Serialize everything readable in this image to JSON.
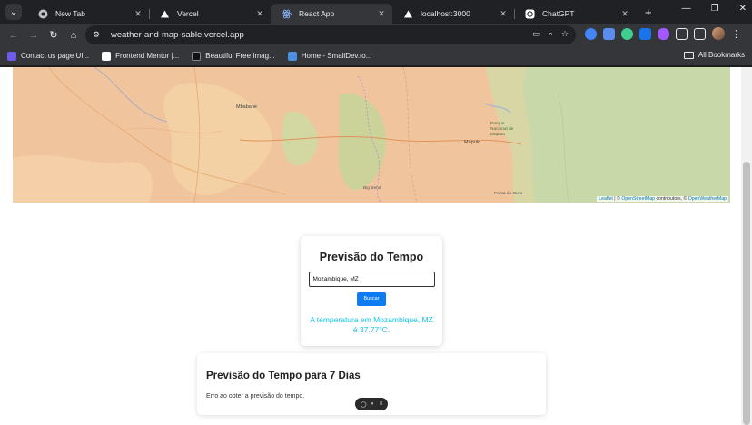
{
  "tabs": [
    {
      "title": "New Tab",
      "icon": "chrome-icon",
      "active": false
    },
    {
      "title": "Vercel",
      "icon": "vercel-triangle-icon",
      "active": false
    },
    {
      "title": "React App",
      "icon": "react-icon",
      "active": true
    },
    {
      "title": "localhost:3000",
      "icon": "vercel-triangle-icon",
      "active": false
    },
    {
      "title": "ChatGPT",
      "icon": "chatgpt-icon",
      "active": false
    }
  ],
  "toolbar": {
    "url": "weather-and-map-sable.vercel.app"
  },
  "bookmarks": [
    {
      "label": "Contact us page UI...",
      "color": "#6c5ce7"
    },
    {
      "label": "Frontend Mentor |...",
      "color": "#ffffff"
    },
    {
      "label": "Beautiful Free Imag...",
      "color": "#111111"
    },
    {
      "label": "Home - SmallDev.to...",
      "color": "#4a90e2"
    }
  ],
  "all_bookmarks": "All Bookmarks",
  "map": {
    "labels": {
      "city1": "Mbabane",
      "city2": "Maputo",
      "park": "Parque Nacional de Maputo",
      "bigbend": "Big Bend",
      "ponta": "Ponta do Ouro"
    },
    "attribution_leaflet": "Leaflet",
    "attribution_osm": "OpenStreetMap",
    "attribution_mid": "contributors, ©",
    "attribution_owm": "OpenWeatherMap"
  },
  "weather_card": {
    "title": "Previsão do Tempo",
    "input_value": "Mozambique, MZ",
    "button_label": "Buscar",
    "temperature_text": "A temperatura em Mozambique, MZ é 37.77°C."
  },
  "forecast": {
    "title": "Previsão do Tempo para 7 Dias",
    "error": "Erro ao obter a previsão do tempo."
  },
  "colors": {
    "accent": "#0d7cf2",
    "temperature": "#17c4ea"
  }
}
